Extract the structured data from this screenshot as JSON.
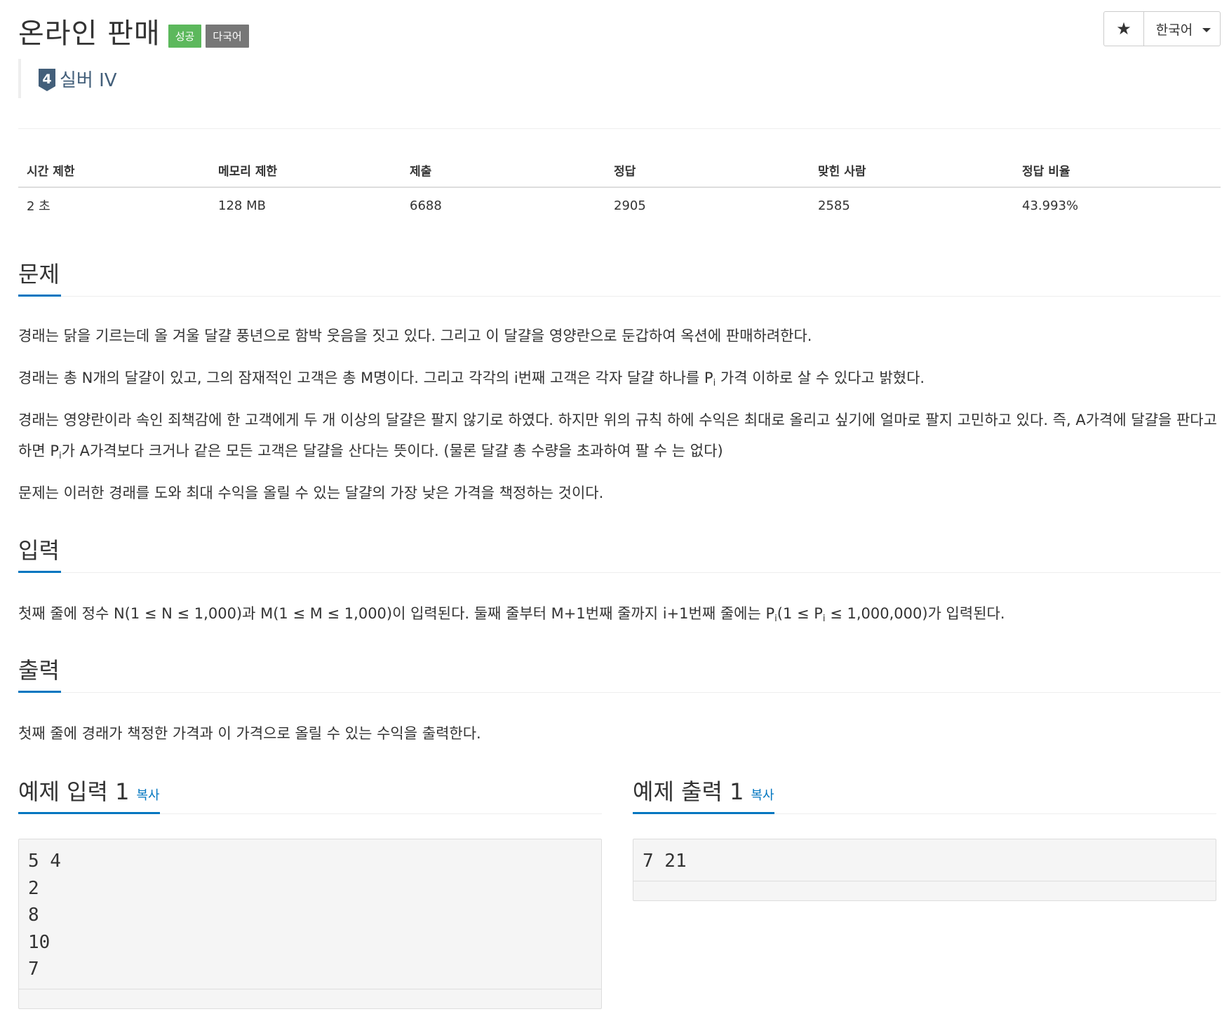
{
  "problem": {
    "title": "온라인 판매",
    "labels": {
      "success": "성공",
      "multilang": "다국어"
    },
    "tier": {
      "badge_number": "4",
      "name": "실버 IV",
      "color": "#435f7a"
    }
  },
  "toolbar": {
    "star_icon": "★",
    "language": "한국어"
  },
  "info_table": {
    "headers": [
      "시간 제한",
      "메모리 제한",
      "제출",
      "정답",
      "맞힌 사람",
      "정답 비율"
    ],
    "values": [
      "2 초",
      "128 MB",
      "6688",
      "2905",
      "2585",
      "43.993%"
    ]
  },
  "sections": {
    "description": {
      "heading": "문제",
      "p1": "경래는 닭을 기르는데 올 겨울 달걀 풍년으로 함박 웃음을 짓고 있다. 그리고 이 달걀을 영양란으로 둔갑하여 옥션에 판매하려한다.",
      "p2_before": "경래는 총 N개의 달걀이 있고, 그의 잠재적인 고객은 총 M명이다. 그리고 각각의 i번째 고객은 각자 달걀 하나를 P",
      "p2_sub": "i",
      "p2_after": " 가격 이하로 살 수 있다고 밝혔다.",
      "p3_before": "경래는 영양란이라 속인 죄책감에 한 고객에게 두 개 이상의 달걀은 팔지 않기로 하였다. 하지만 위의 규칙 하에 수익은 최대로 올리고 싶기에 얼마로 팔지 고민하고 있다. 즉, A가격에 달걀을 판다고 하면 P",
      "p3_sub": "i",
      "p3_after": "가 A가격보다 크거나 같은 모든 고객은 달걀을 산다는 뜻이다. (물론 달걀 총 수량을 초과하여 팔 수 는 없다)",
      "p4": "문제는 이러한 경래를 도와 최대 수익을 올릴 수 있는 달걀의 가장 낮은 가격을 책정하는 것이다."
    },
    "input": {
      "heading": "입력",
      "text_a": "첫째 줄에 정수 N(1 ≤ N ≤ 1,000)과 M(1 ≤ M ≤ 1,000)이 입력된다. 둘째 줄부터 M+1번째 줄까지 i+1번째 줄에는 P",
      "sub_a": "i",
      "text_b": "(1 ≤ P",
      "sub_b": "i",
      "text_c": " ≤ 1,000,000)가 입력된다."
    },
    "output": {
      "heading": "출력",
      "text": "첫째 줄에 경래가 책정한 가격과 이 가격으로 올릴 수 있는 수익을 출력한다."
    }
  },
  "samples": {
    "input1": {
      "heading": "예제 입력 1",
      "copy": "복사",
      "content": "5 4\n2\n8\n10\n7"
    },
    "output1": {
      "heading": "예제 출력 1",
      "copy": "복사",
      "content": "7 21"
    }
  },
  "colors": {
    "accent": "#0076c0",
    "success": "#5cb85c",
    "multilang": "#777777"
  }
}
